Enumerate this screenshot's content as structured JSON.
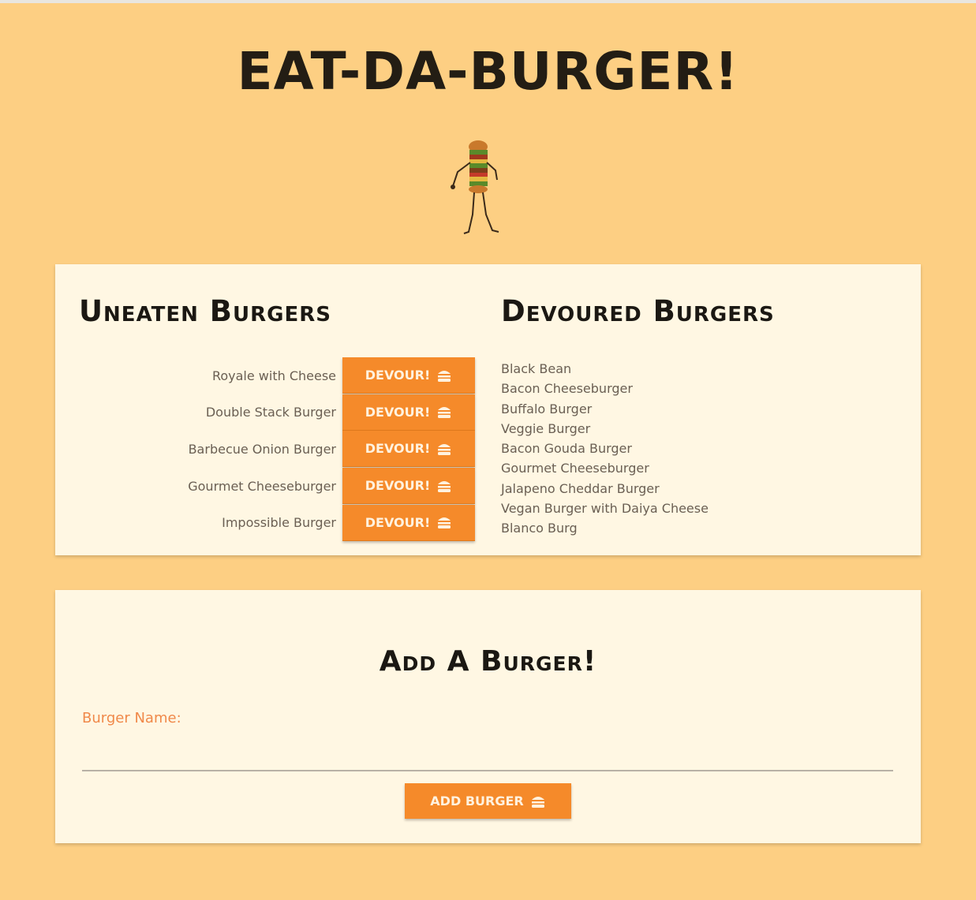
{
  "header": {
    "title": "EAT-DA-BURGER!",
    "mascot_icon": "dancing-burger-icon"
  },
  "uneaten": {
    "heading": "Uneaten Burgers",
    "button_label": "DEVOUR!",
    "button_icon": "burger-icon",
    "items": [
      {
        "name": "Royale with Cheese"
      },
      {
        "name": "Double Stack Burger"
      },
      {
        "name": "Barbecue Onion Burger"
      },
      {
        "name": "Gourmet Cheeseburger"
      },
      {
        "name": "Impossible Burger"
      }
    ]
  },
  "devoured": {
    "heading": "Devoured Burgers",
    "items": [
      "Black Bean",
      "Bacon Cheeseburger",
      "Buffalo Burger",
      "Veggie Burger",
      "Bacon Gouda Burger",
      "Gourmet Cheeseburger",
      "Jalapeno Cheddar Burger",
      "Vegan Burger with Daiya Cheese",
      "Blanco Burg"
    ]
  },
  "add_form": {
    "heading": "Add A Burger!",
    "label": "Burger Name:",
    "input_value": "",
    "button_label": "ADD BURGER",
    "button_icon": "burger-icon"
  },
  "colors": {
    "background": "#fdcf83",
    "card": "#fff7e3",
    "accent": "#f58a2a",
    "label": "#f0894a"
  }
}
